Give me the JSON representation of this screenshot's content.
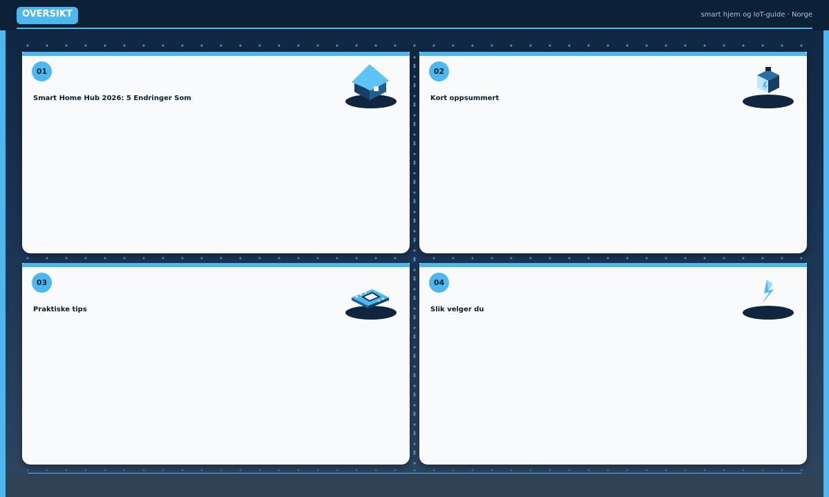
{
  "header": {
    "badge": "OVERSIKT",
    "subtitle": "smart hjem og IoT-guide · Norge"
  },
  "cards": [
    {
      "number": "01",
      "title": "Smart Home Hub 2026: 5 Endringer Som",
      "icon": "house-icon"
    },
    {
      "number": "02",
      "title": "Kort oppsummert",
      "icon": "cube-icon"
    },
    {
      "number": "03",
      "title": "Praktiske tips",
      "icon": "chip-icon"
    },
    {
      "number": "04",
      "title": "Slik velger du",
      "icon": "lightning-icon"
    }
  ],
  "colors": {
    "accent": "#4cb8ee",
    "header_bg": "#0c2038",
    "card_bg": "#f8fafc",
    "icon_dark": "#10263f"
  }
}
